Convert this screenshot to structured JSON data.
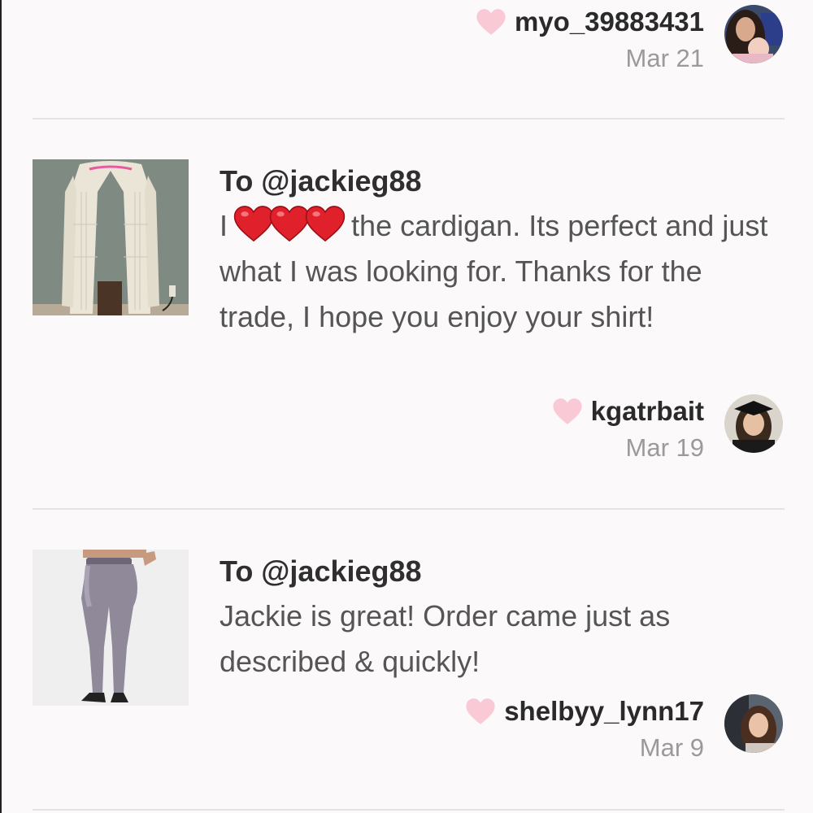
{
  "reviews": [
    {
      "username": "myo_39883431",
      "date": "Mar 21"
    },
    {
      "title": "To @jackieg88",
      "message_prefix": "I",
      "message_rest": "the cardigan. Its perfect and just what I was looking for. Thanks for the trade, I hope you enjoy your shirt!",
      "username": "kgatrbait",
      "date": "Mar 19"
    },
    {
      "title": "To @jackieg88",
      "message": "Jackie is great! Order came just as described & quickly!",
      "username": "shelbyy_lynn17",
      "date": "Mar 9"
    }
  ],
  "colors": {
    "heart_pink": "#f9c9d6",
    "emoji_red": "#e0202a",
    "divider": "#e5e3e4"
  }
}
